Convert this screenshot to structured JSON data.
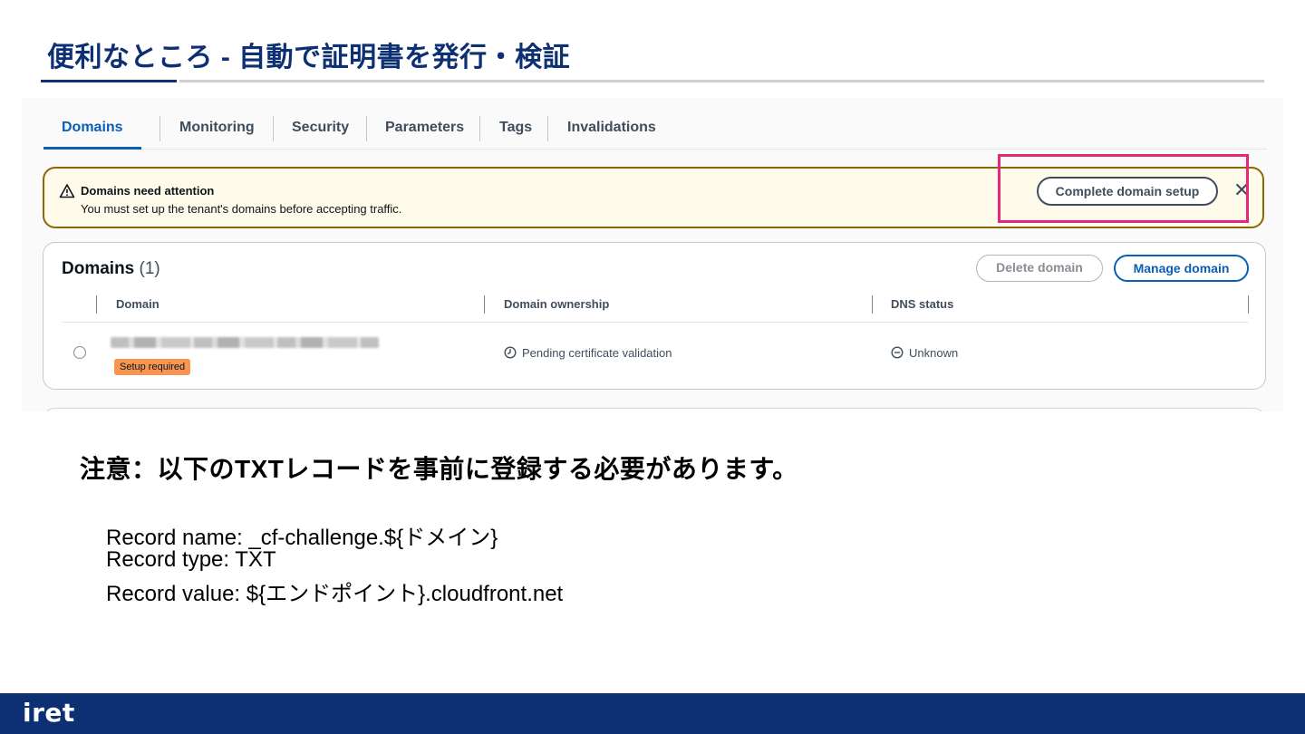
{
  "slide": {
    "title": "便利なところ - 自動で証明書を発行・検証",
    "notice": "注意：以下のTXTレコードを事前に登録する必要があります。",
    "records": [
      "Record name: _cf-challenge.${ドメイン}",
      "Record type: TXT",
      "Record value: ${エンドポイント}.cloudfront.net"
    ],
    "logo": "iret"
  },
  "tabs": [
    {
      "label": "Domains",
      "active": true
    },
    {
      "label": "Monitoring",
      "active": false
    },
    {
      "label": "Security",
      "active": false
    },
    {
      "label": "Parameters",
      "active": false
    },
    {
      "label": "Tags",
      "active": false
    },
    {
      "label": "Invalidations",
      "active": false
    }
  ],
  "alert": {
    "title": "Domains need attention",
    "text": "You must set up the tenant's domains before accepting traffic.",
    "action_label": "Complete domain setup",
    "icon": "warning-icon"
  },
  "domains_card": {
    "title": "Domains",
    "count": "(1)",
    "delete_label": "Delete domain",
    "manage_label": "Manage domain",
    "columns": [
      "Domain",
      "Domain ownership",
      "DNS status"
    ],
    "rows": [
      {
        "domain": "",
        "badge": "Setup required",
        "ownership": "Pending certificate validation",
        "dns_status": "Unknown"
      }
    ]
  },
  "colors": {
    "title_blue": "#0d2f73",
    "tab_active": "#0a5fb5",
    "alert_border": "#8d6605",
    "highlight": "#e4287a",
    "badge": "#f79552"
  }
}
